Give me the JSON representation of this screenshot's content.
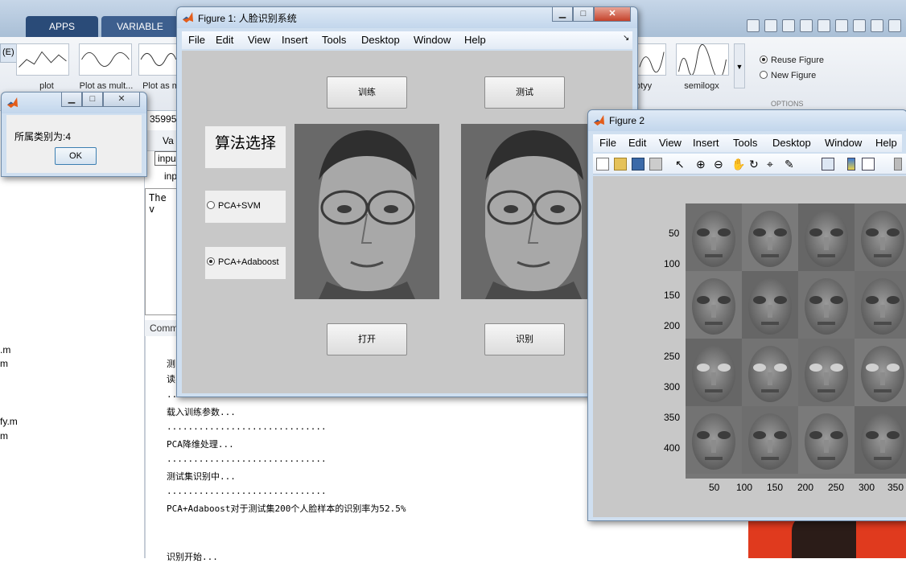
{
  "desktop": {
    "ribbon_tabs": [
      "APPS",
      "VARIABLE"
    ],
    "gallery_labels": [
      "plot",
      "Plot as mult...",
      "Plot as m",
      "otyy",
      "semilogx"
    ],
    "edit_label": "(E)",
    "figure_options": {
      "reuse": "Reuse Figure",
      "new": "New Figure",
      "section": "OPTIONS"
    },
    "variables_tab": "Va",
    "input_field": "inpu",
    "input_label": "inp",
    "partial_number": "35995",
    "editor_snippet": "The v",
    "command_window_label": "Comm",
    "files": [
      ".m",
      "m",
      "fy.m",
      "m"
    ],
    "command_output": [
      "测",
      "读",
      "..............................",
      "载入训练参数...",
      "..............................",
      "PCA降维处理...",
      "..............................",
      "测试集识别中...",
      "..............................",
      "PCA+Adaboost对于测试集200个人脸样本的识别率为52.5%",
      "识别开始..."
    ]
  },
  "figure1": {
    "title": "Figure 1: 人脸识别系统",
    "menus": [
      "File",
      "Edit",
      "View",
      "Insert",
      "Tools",
      "Desktop",
      "Window",
      "Help"
    ],
    "buttons": {
      "train": "训练",
      "test": "测试",
      "open": "打开",
      "recognize": "识别"
    },
    "algo_title": "算法选择",
    "options": [
      {
        "label": "PCA+SVM",
        "selected": false
      },
      {
        "label": "PCA+Adaboost",
        "selected": true
      }
    ]
  },
  "figure2": {
    "title": "Figure 2",
    "menus": [
      "File",
      "Edit",
      "View",
      "Insert",
      "Tools",
      "Desktop",
      "Window",
      "Help"
    ],
    "y_ticks": [
      "50",
      "100",
      "150",
      "200",
      "250",
      "300",
      "350",
      "400"
    ],
    "x_ticks": [
      "50",
      "100",
      "150",
      "200",
      "250",
      "300",
      "350"
    ]
  },
  "msgbox": {
    "text": "所属类别为:4",
    "ok": "OK"
  }
}
